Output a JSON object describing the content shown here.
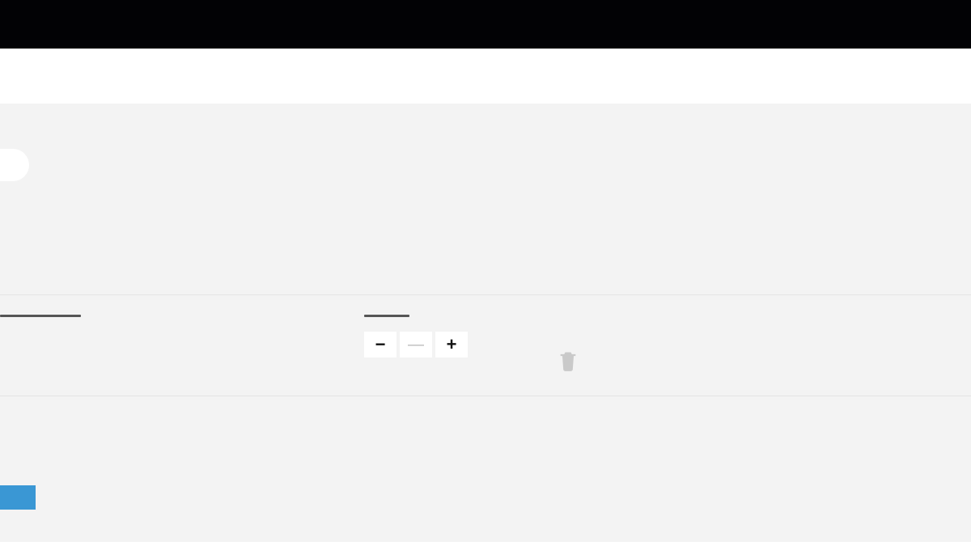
{
  "icons": {
    "minus": "−",
    "plus": "+"
  },
  "cart": {
    "row": {
      "qty_value": "—"
    }
  },
  "progress": {
    "percent": 4,
    "fill_color": "#3a97d4"
  },
  "colors": {
    "topbar": "#020205",
    "page_bg": "#f3f3f3",
    "divider": "#e4e4e4",
    "icon_muted": "#c9c9c9"
  }
}
